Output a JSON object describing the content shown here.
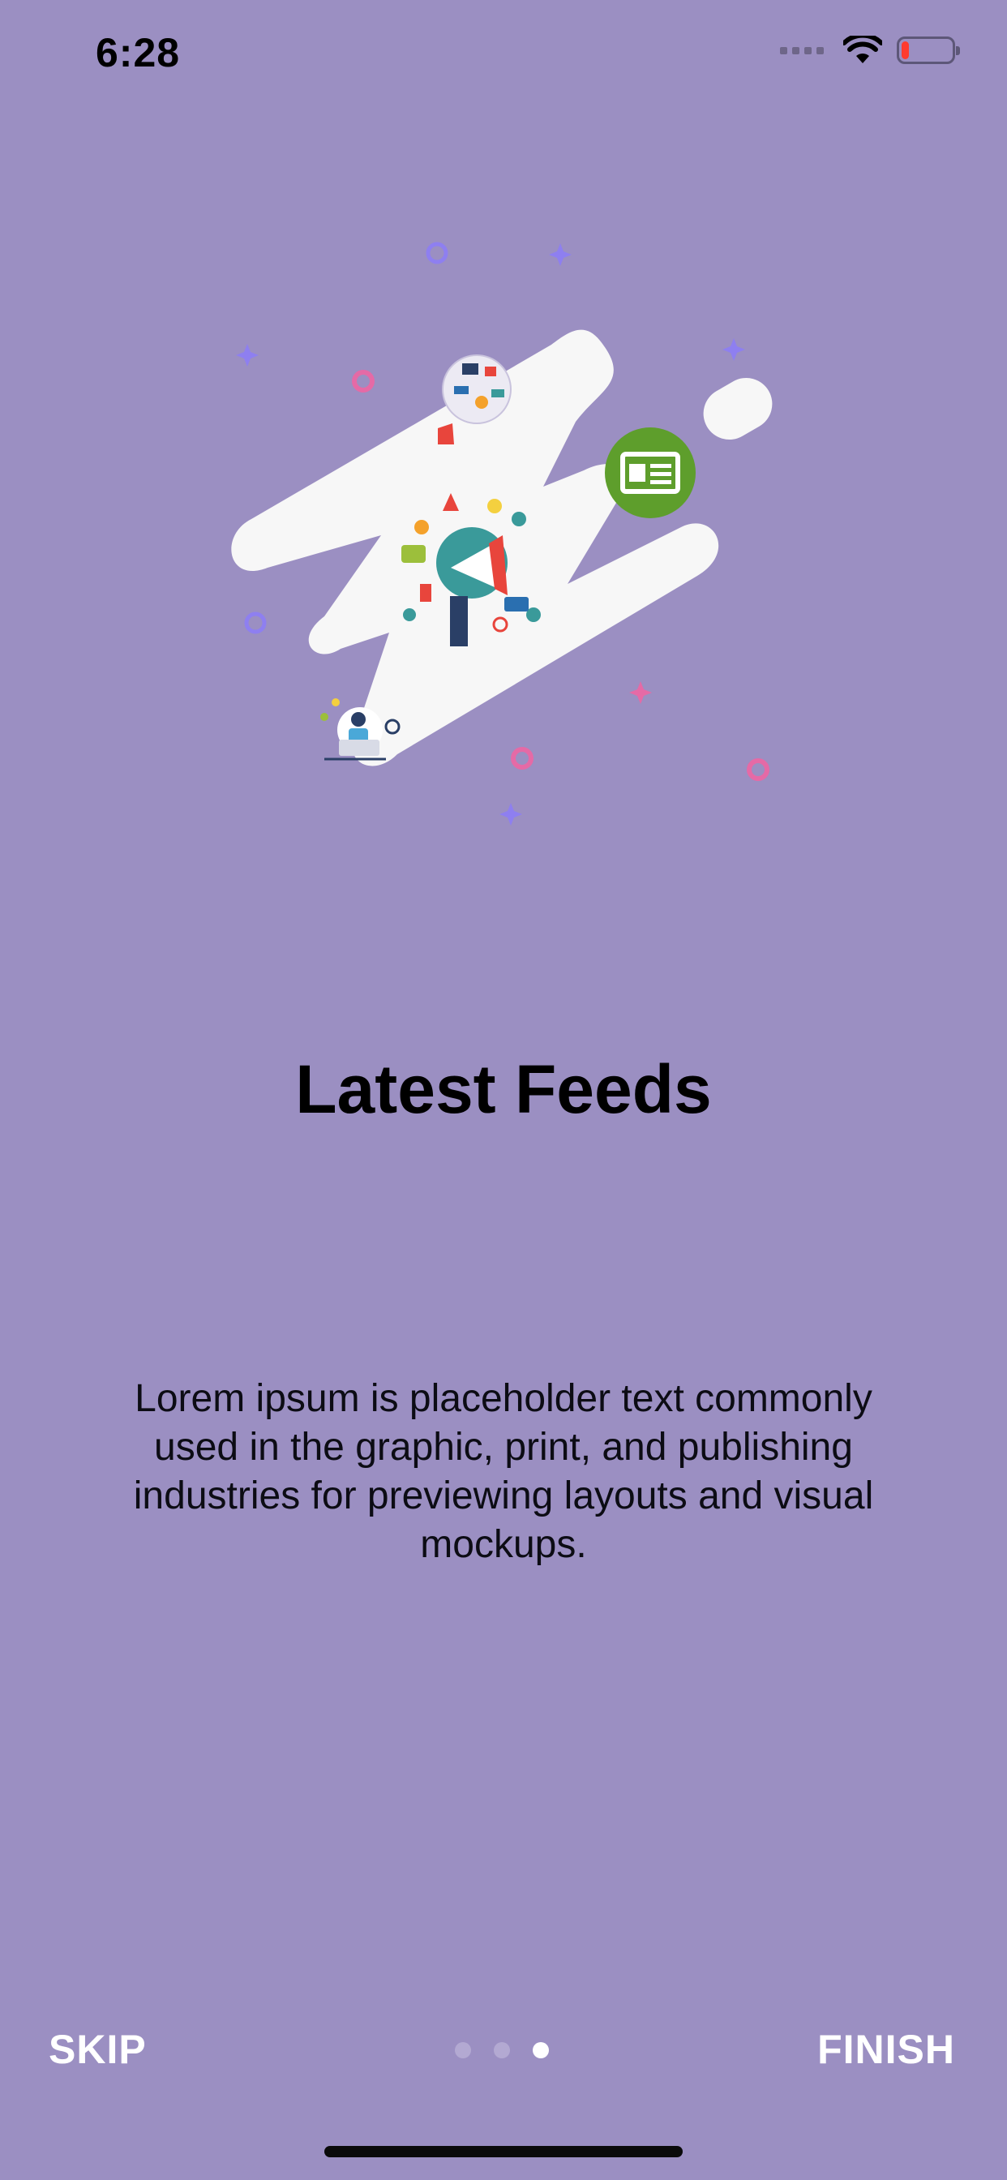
{
  "status_bar": {
    "time": "6:28",
    "icons": [
      "signal-dots-icon",
      "wifi-icon",
      "battery-low-icon"
    ],
    "battery_level": 0.15
  },
  "onboarding": {
    "title": "Latest Feeds",
    "body": "Lorem ipsum is placeholder text commonly used in the graphic, print, and publishing industries for previewing layouts and visual mockups.",
    "illustration_icons": [
      "megaphone-icon",
      "news-feed-icon",
      "person-laptop-icon",
      "social-media-icon"
    ],
    "feed_badge_color": "#5e9e2c"
  },
  "navigation": {
    "skip_label": "SKIP",
    "finish_label": "FINISH",
    "page_count": 3,
    "current_page": 3
  },
  "colors": {
    "background": "#9b8fc2",
    "accent_pink": "#e56aa6",
    "accent_purple": "#8e7ff0"
  }
}
